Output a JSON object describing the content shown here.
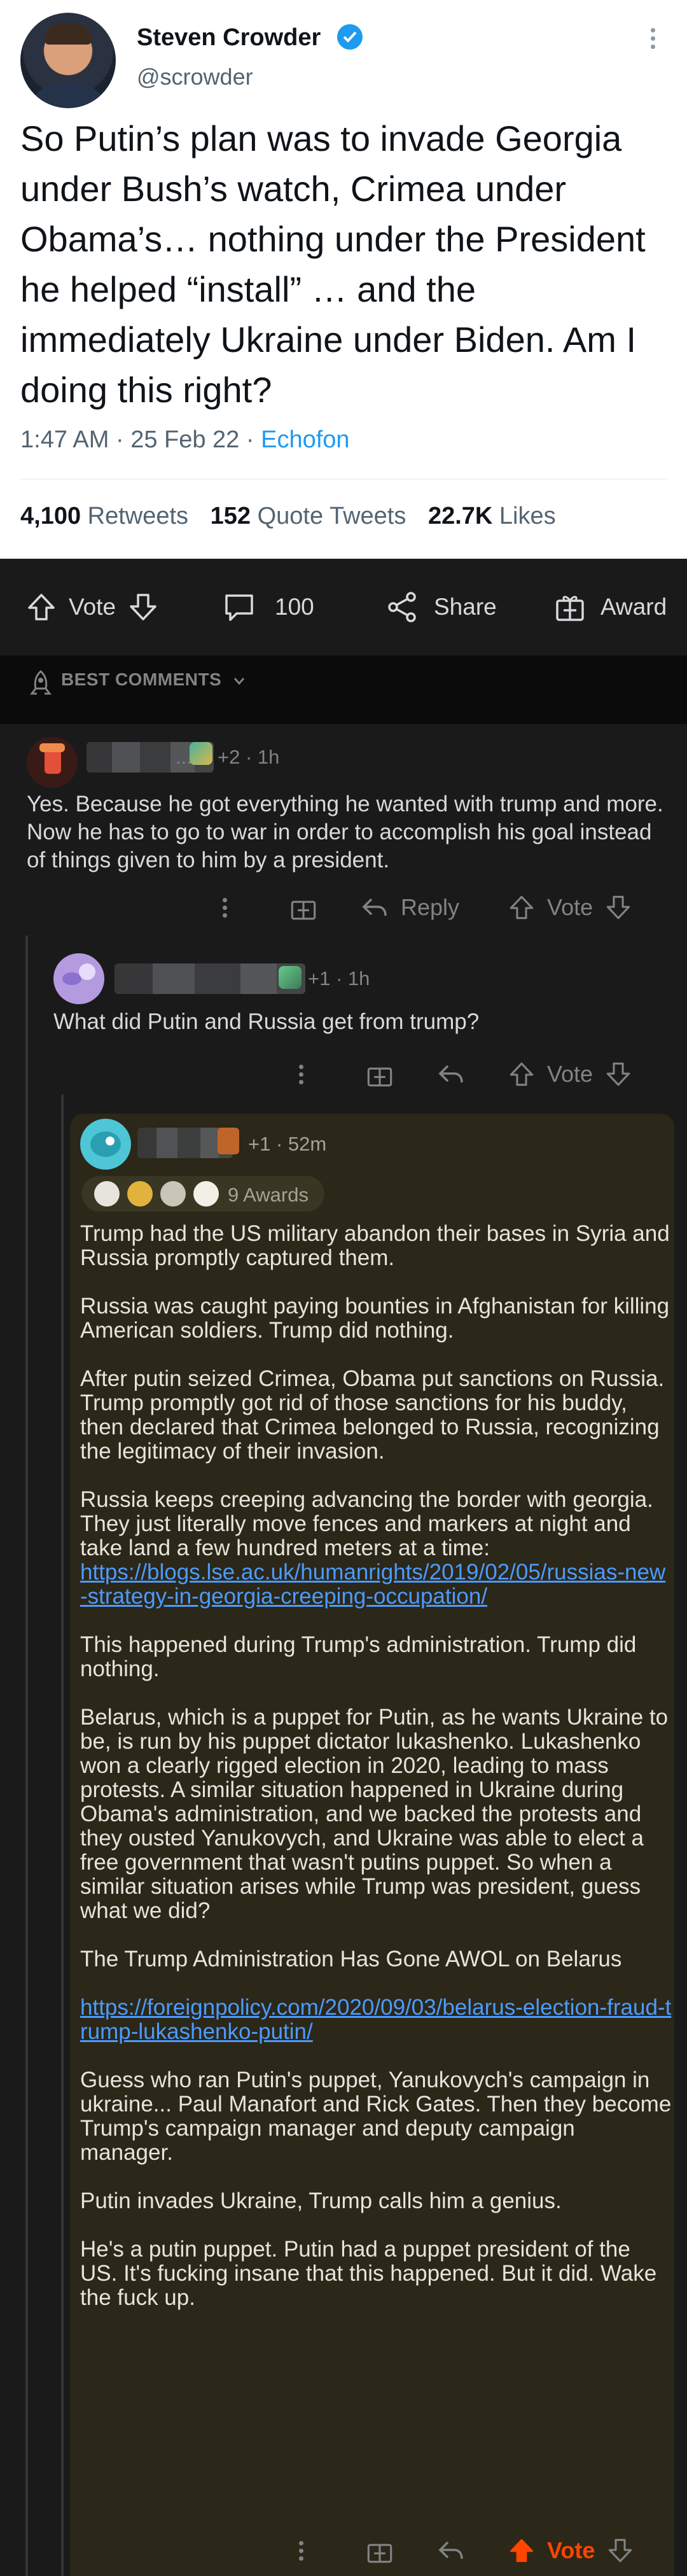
{
  "tweet": {
    "name": "Steven Crowder",
    "handle": "@scrowder",
    "text": "So Putin’s plan was to invade Georgia under Bush’s watch, Crimea under Obama’s… nothing under the President he helped “install” … and the immediately Ukraine under Biden. Am I doing this right?",
    "time": "1:47 AM · 25 Feb 22 · ",
    "source": "Echofon",
    "retweets_count": "4,100",
    "retweets_label": "Retweets",
    "quotes_count": "152",
    "quotes_label": "Quote Tweets",
    "likes_count": "22.7K",
    "likes_label": "Likes"
  },
  "post_actions": {
    "vote_label": "Vote",
    "comments_count": "100",
    "share_label": "Share",
    "award_label": "Award"
  },
  "sort": {
    "label": "BEST COMMENTS"
  },
  "comments": [
    {
      "meta": "+2 · 1h",
      "text": "Yes. Because he got everything he wanted with trump and more. Now he has to go to war in order to accomplish his goal instead of things given to him by a president.",
      "reply_label": "Reply",
      "vote_label": "Vote"
    },
    {
      "meta": "+1 · 1h",
      "text": "What did Putin and Russia get from trump?",
      "vote_label": "Vote"
    },
    {
      "meta": "+1 · 52m",
      "awards": "9 Awards",
      "vote_label": "Vote",
      "paragraphs": {
        "p1": "Trump had the US military abandon their bases in Syria and Russia promptly captured them.",
        "p2": "Russia was caught paying bounties in Afghanistan for killing American soldiers. Trump did nothing.",
        "p3": "After putin seized Crimea, Obama put sanctions on Russia. Trump promptly got rid of those sanctions for his buddy, then declared that Crimea belonged to Russia, recognizing the legitimacy of their invasion.",
        "p4": "Russia keeps creeping advancing the border with georgia. They just literally move fences and markers at night and take land a few hundred meters at a time:",
        "link1": "https://blogs.lse.ac.uk/humanrights/2019/02/05/russias-new-strategy-in-georgia-creeping-occupation/",
        "p5": "This happened during Trump's administration. Trump did nothing.",
        "p6": "Belarus, which is a puppet for Putin, as he wants Ukraine to be, is run by his puppet dictator lukashenko. Lukashenko won a clearly rigged election in 2020, leading to mass protests. A similar situation happened in Ukraine during Obama's administration, and we backed the protests and they ousted Yanukovych, and Ukraine was able to elect a free government that wasn't putins puppet. So when a similar situation arises while Trump was president,  guess what we did?",
        "p7": "The Trump Administration Has Gone AWOL on Belarus",
        "link2": "https://foreignpolicy.com/2020/09/03/belarus-election-fraud-trump-lukashenko-putin/",
        "p8": "Guess who ran Putin's puppet, Yanukovych's campaign in ukraine... Paul Manafort and Rick Gates. Then they become Trump's campaign manager and deputy campaign manager.",
        "p9": "Putin invades Ukraine, Trump calls him a genius.",
        "p10": "He's a putin puppet. Putin had a puppet president of the US. It's fucking insane that this happened. But it did. Wake the fuck up."
      }
    }
  ],
  "colors": {
    "upvote": "#ff4500",
    "twitter_blue": "#1d9bf0",
    "nested_bg": "#2b2719"
  }
}
